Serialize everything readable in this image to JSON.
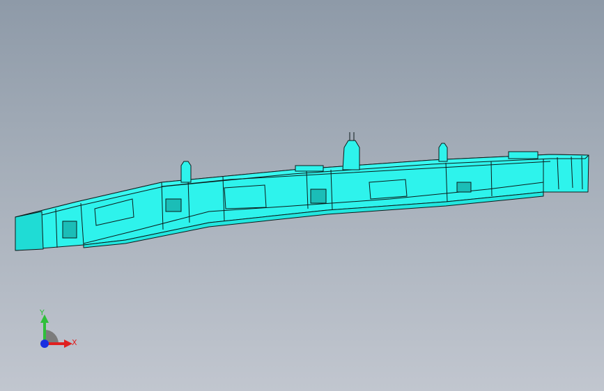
{
  "viewport": {
    "background_top": "#8e9aa8",
    "background_bottom": "#c1c6cf"
  },
  "model": {
    "fill_color": "#2ef3ec",
    "shade_color": "#1fcfc8",
    "edge_color": "#0b1a1a"
  },
  "triad": {
    "y_label": "Y",
    "x_label": "X",
    "y_color": "#2fbf3a",
    "x_color": "#e02020",
    "z_color": "#1a2fe0"
  }
}
